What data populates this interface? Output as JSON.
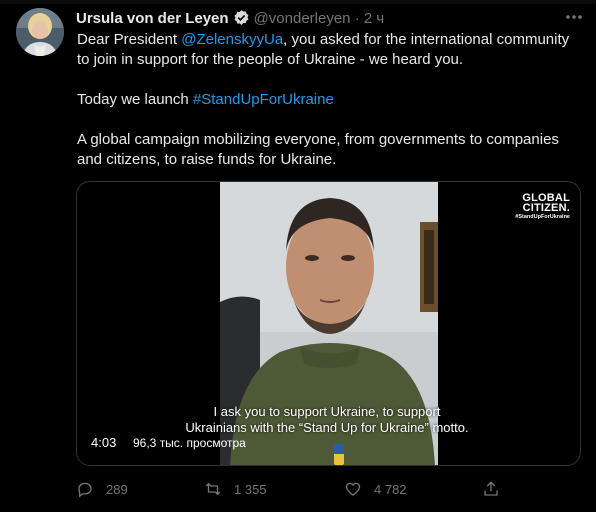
{
  "tweet": {
    "author_name": "Ursula von der Leyen",
    "handle": "@vonderleyen",
    "separator": "·",
    "time": "2 ч",
    "text": {
      "line1_pre": "Dear President ",
      "mention": "@ZelenskyyUa",
      "line1_post": ", you asked for the international community to join in support for the people of Ukraine - we heard you.",
      "para2_pre": "Today we launch ",
      "hashtag": "#StandUpForUkraine",
      "para3": "A global campaign mobilizing everyone, from governments to companies and citizens, to raise funds for Ukraine."
    },
    "media": {
      "logo_line1": "GLOBAL",
      "logo_line2": "CITIZEN.",
      "logo_tag": "#StandUpForUkraine",
      "caption_line1": "I ask you to support Ukraine, to support",
      "caption_line2": "Ukrainians with the “Stand Up for Ukraine” motto.",
      "duration": "4:03",
      "views": "96,3 тыс. просмотра"
    },
    "actions": {
      "replies": "289",
      "retweets": "1 355",
      "likes": "4 782"
    }
  },
  "colors": {
    "background": "#000000",
    "link": "#1d9bf0",
    "muted": "#71767b",
    "verified": "#1d9bf0"
  }
}
